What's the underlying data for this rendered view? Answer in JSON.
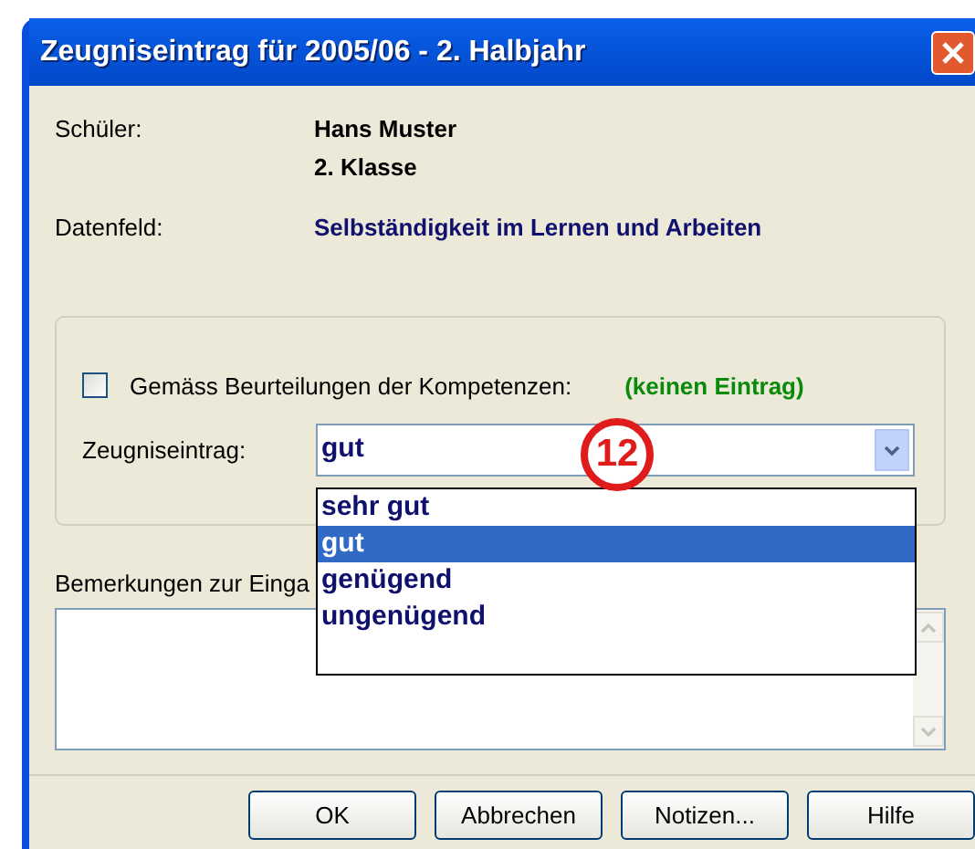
{
  "window": {
    "title": "Zeugniseintrag für 2005/06 - 2. Halbjahr"
  },
  "student": {
    "label": "Schüler:",
    "name": "Hans Muster",
    "class": "2. Klasse"
  },
  "data_field": {
    "label": "Datenfeld:",
    "value": "Selbständigkeit im Lernen und Arbeiten"
  },
  "competence": {
    "label": "Gemäss Beurteilungen der Kompetenzen:",
    "checked": false,
    "value": "(keinen Eintrag)"
  },
  "report_entry": {
    "label": "Zeugniseintrag:",
    "value": "gut",
    "expanded": true,
    "options": [
      {
        "label": "sehr gut",
        "selected": false
      },
      {
        "label": "gut",
        "selected": true
      },
      {
        "label": "genügend",
        "selected": false
      },
      {
        "label": "ungenügend",
        "selected": false
      }
    ]
  },
  "annotation": "12",
  "remarks": {
    "label": "Bemerkungen zur Einga"
  },
  "buttons": [
    "OK",
    "Abbrechen",
    "Notizen...",
    "Hilfe"
  ]
}
